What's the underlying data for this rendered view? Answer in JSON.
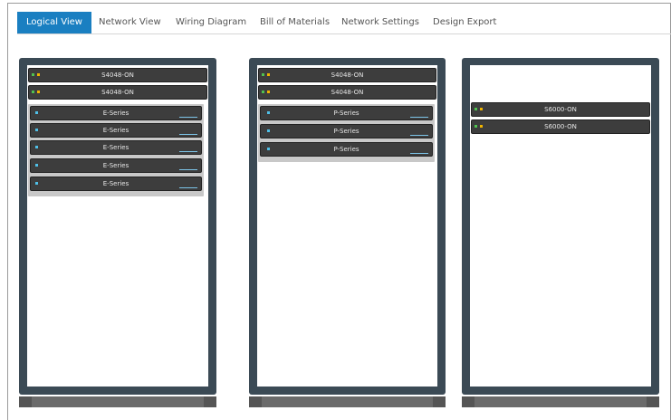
{
  "tabs": [
    {
      "label": "Logical View",
      "active": true
    },
    {
      "label": "Network View",
      "active": false
    },
    {
      "label": "Wiring Diagram",
      "active": false
    },
    {
      "label": "Bill of Materials",
      "active": false
    },
    {
      "label": "Network Settings",
      "active": false
    },
    {
      "label": "Design Export",
      "active": false
    }
  ],
  "racks": [
    {
      "switches": [
        "S4048-ON",
        "S4048-ON"
      ],
      "servers": [
        "E-Series",
        "E-Series",
        "E-Series",
        "E-Series",
        "E-Series"
      ]
    },
    {
      "switches": [
        "S4048-ON",
        "S4048-ON"
      ],
      "servers": [
        "P-Series",
        "P-Series",
        "P-Series"
      ]
    },
    {
      "switches": [
        "S6000-ON",
        "S6000-ON"
      ],
      "servers": []
    }
  ],
  "colors": {
    "accent": "#1a7fc1",
    "rack": "#3b4a55",
    "device": "#3d3d3d",
    "led_green": "#4fc24f",
    "led_yellow": "#f0b400",
    "led_blue": "#4fc0e8"
  }
}
